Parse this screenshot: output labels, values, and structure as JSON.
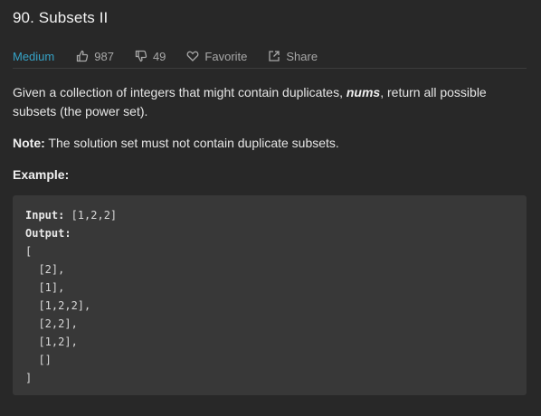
{
  "problem": {
    "title": "90. Subsets II",
    "difficulty": "Medium",
    "likes": "987",
    "dislikes": "49",
    "favorite_label": "Favorite",
    "share_label": "Share"
  },
  "description": {
    "para1_prefix": "Given a collection of integers that might contain duplicates, ",
    "para1_var": "nums",
    "para1_suffix": ", return all possible subsets (the power set).",
    "note_label": "Note:",
    "note_text": " The solution set must not contain duplicate subsets.",
    "example_heading": "Example:"
  },
  "example": {
    "input_label": "Input:",
    "input_value": " [1,2,2]",
    "output_label": "Output:",
    "output_lines": [
      "[",
      "  [2],",
      "  [1],",
      "  [1,2,2],",
      "  [2,2],",
      "  [1,2],",
      "  []",
      "]"
    ]
  },
  "icons": {
    "like": "thumbs-up-icon",
    "dislike": "thumbs-down-icon",
    "favorite": "heart-icon",
    "share": "share-icon"
  },
  "colors": {
    "background": "#282828",
    "difficulty_medium": "#36a3c7",
    "code_background": "#383838"
  }
}
